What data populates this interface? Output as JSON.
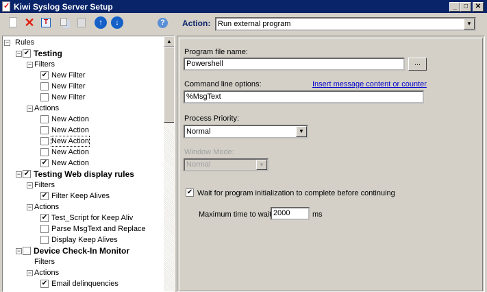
{
  "window": {
    "title": "Kiwi Syslog Server Setup",
    "minimize": "_",
    "maximize": "□",
    "close": "✕"
  },
  "toolbar": {
    "icons": [
      "new-icon",
      "delete-icon",
      "rename-icon",
      "copy-icon",
      "paste-icon",
      "move-up-icon",
      "move-down-icon",
      "help-icon"
    ],
    "action_label": "Action:",
    "action_value": "Run external program"
  },
  "tree": [
    {
      "label": "Rules",
      "level": 0,
      "exp": "−",
      "cb": null,
      "bold": false
    },
    {
      "label": "Testing",
      "level": 1,
      "exp": "−",
      "cb": true,
      "bold": true
    },
    {
      "label": "Filters",
      "level": 2,
      "exp": "−",
      "cb": null,
      "bold": false
    },
    {
      "label": "New Filter",
      "level": 3,
      "exp": null,
      "cb": true,
      "bold": false
    },
    {
      "label": "New Filter",
      "level": 3,
      "exp": null,
      "cb": false,
      "bold": false
    },
    {
      "label": "New Filter",
      "level": 3,
      "exp": null,
      "cb": false,
      "bold": false
    },
    {
      "label": "Actions",
      "level": 2,
      "exp": "−",
      "cb": null,
      "bold": false
    },
    {
      "label": "New Action",
      "level": 3,
      "exp": null,
      "cb": false,
      "bold": false
    },
    {
      "label": "New Action",
      "level": 3,
      "exp": null,
      "cb": false,
      "bold": false
    },
    {
      "label": "New Action",
      "level": 3,
      "exp": null,
      "cb": false,
      "bold": false,
      "selected": true
    },
    {
      "label": "New Action",
      "level": 3,
      "exp": null,
      "cb": false,
      "bold": false
    },
    {
      "label": "New Action",
      "level": 3,
      "exp": null,
      "cb": true,
      "bold": false
    },
    {
      "label": "Testing Web display rules",
      "level": 1,
      "exp": "−",
      "cb": true,
      "bold": true
    },
    {
      "label": "Filters",
      "level": 2,
      "exp": "−",
      "cb": null,
      "bold": false
    },
    {
      "label": "Filter Keep Alives",
      "level": 3,
      "exp": null,
      "cb": true,
      "bold": false
    },
    {
      "label": "Actions",
      "level": 2,
      "exp": "−",
      "cb": null,
      "bold": false
    },
    {
      "label": "Test_Script for Keep Aliv",
      "level": 3,
      "exp": null,
      "cb": true,
      "bold": false
    },
    {
      "label": "Parse MsgText and Replace",
      "level": 3,
      "exp": null,
      "cb": false,
      "bold": false
    },
    {
      "label": "Display Keep Alives",
      "level": 3,
      "exp": null,
      "cb": false,
      "bold": false
    },
    {
      "label": "Device Check-In Monitor",
      "level": 1,
      "exp": "−",
      "cb": false,
      "bold": true
    },
    {
      "label": "Filters",
      "level": 2,
      "exp": null,
      "cb": null,
      "bold": false
    },
    {
      "label": "Actions",
      "level": 2,
      "exp": "−",
      "cb": null,
      "bold": false
    },
    {
      "label": "Email delinquencies",
      "level": 3,
      "exp": null,
      "cb": true,
      "bold": false
    }
  ],
  "form": {
    "program_label": "Program file name:",
    "program_value": "Powershell",
    "browse": "...",
    "cmd_label": "Command line options:",
    "insert_link": "Insert message content or counter",
    "cmd_value": "%MsgText",
    "priority_label": "Process Priority:",
    "priority_value": "Normal",
    "window_label": "Window Mode:",
    "window_value": "Normal",
    "wait_label": "Wait for program initialization to complete before continuing",
    "wait_checked": true,
    "max_label": "Maximum time to wait:",
    "max_value": "2000",
    "max_unit": "ms"
  }
}
